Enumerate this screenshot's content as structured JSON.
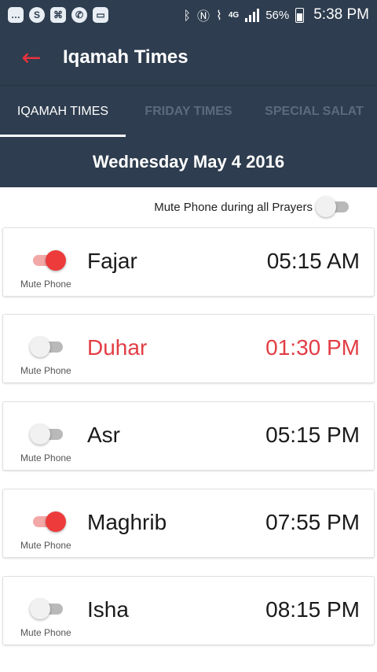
{
  "status_bar": {
    "battery_percent": "56%",
    "time": "5:38 PM",
    "network": "4G",
    "left_icons": [
      "messages-icon",
      "skype-icon",
      "pdf-icon",
      "whatsapp-icon",
      "gallery-icon"
    ],
    "right_icons": [
      "bluetooth-icon",
      "nfc-icon",
      "vibrate-icon",
      "data-icon",
      "signal-icon",
      "battery-icon"
    ]
  },
  "app_bar": {
    "title": "Iqamah Times",
    "back_icon": "back-arrow-icon",
    "back_color": "#e8323d"
  },
  "tabs": [
    {
      "label": "IQAMAH TIMES",
      "active": true
    },
    {
      "label": "FRIDAY TIMES",
      "active": false
    },
    {
      "label": "SPECIAL SALAT",
      "active": false
    }
  ],
  "date": "Wednesday May 4 2016",
  "mute_all": {
    "label": "Mute Phone during all Prayers",
    "on": false
  },
  "prayers": [
    {
      "name": "Fajar",
      "time": "05:15 AM",
      "mute_label": "Mute Phone",
      "mute_on": true,
      "current": false
    },
    {
      "name": "Duhar",
      "time": "01:30 PM",
      "mute_label": "Mute Phone",
      "mute_on": false,
      "current": true
    },
    {
      "name": "Asr",
      "time": "05:15 PM",
      "mute_label": "Mute Phone",
      "mute_on": false,
      "current": false
    },
    {
      "name": "Maghrib",
      "time": "07:55 PM",
      "mute_label": "Mute Phone",
      "mute_on": true,
      "current": false
    },
    {
      "name": "Isha",
      "time": "08:15 PM",
      "mute_label": "Mute Phone",
      "mute_on": false,
      "current": false
    }
  ],
  "colors": {
    "header_bg": "#2e3d4f",
    "accent_red": "#e23d45",
    "switch_on": "#ed3b3b",
    "switch_off": "#b9b9b9"
  }
}
